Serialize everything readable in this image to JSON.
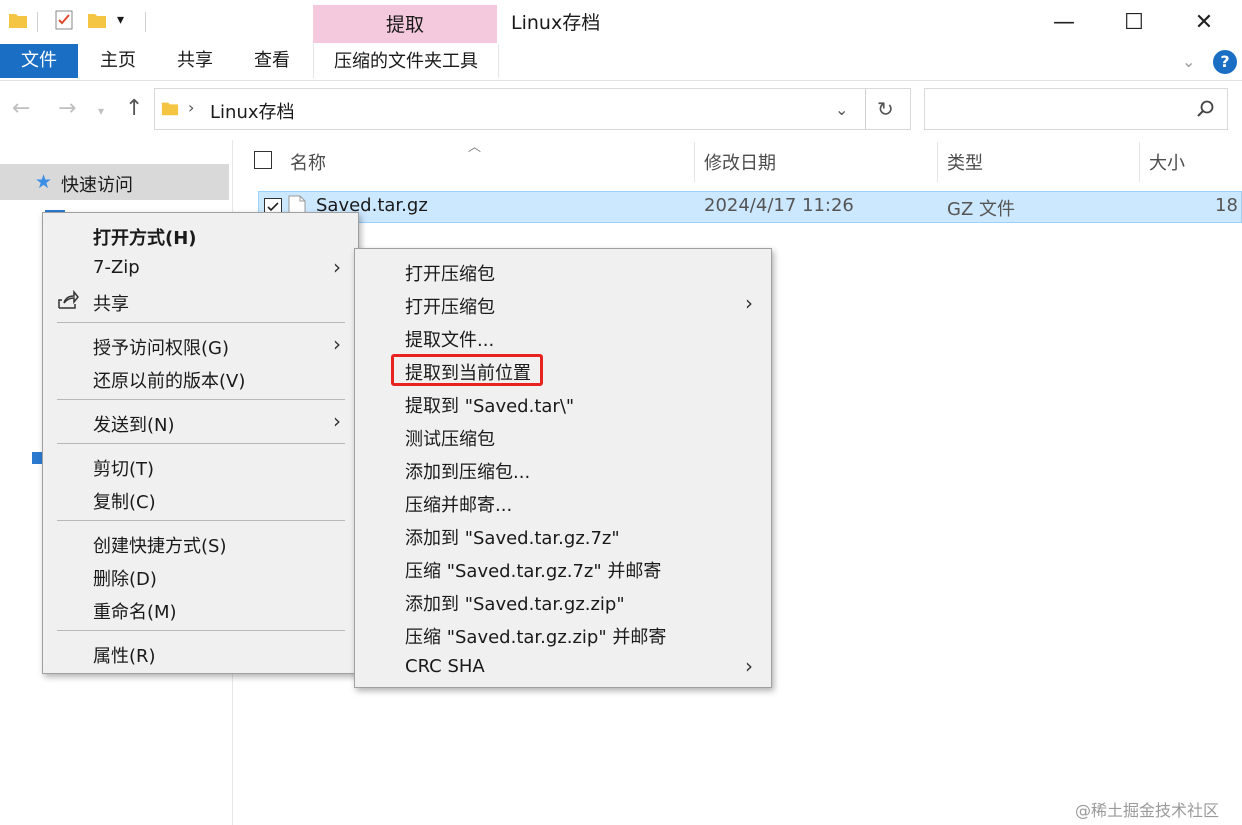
{
  "window": {
    "title": "Linux存档",
    "context_tab": "提取",
    "minimize_glyph": "—",
    "maximize_glyph": "☐",
    "close_glyph": "✕"
  },
  "ribbon": {
    "tabs": [
      "文件",
      "主页",
      "共享",
      "查看"
    ],
    "tools_tab": "压缩的文件夹工具",
    "help_glyph": "?"
  },
  "address": {
    "path": "Linux存档",
    "search_placeholder": ""
  },
  "nav": {
    "quick_access": "快速访问"
  },
  "columns": {
    "name": "名称",
    "modified": "修改日期",
    "type": "类型",
    "size": "大小"
  },
  "files": [
    {
      "name": "Saved.tar.gz",
      "modified": "2024/4/17 11:26",
      "type": "GZ 文件",
      "size": "18"
    }
  ],
  "context_menu": {
    "items": [
      {
        "label": "打开方式(H)",
        "bold": true
      },
      {
        "label": "7-Zip",
        "submenu": true
      },
      {
        "label": "共享"
      },
      {
        "label": "授予访问权限(G)",
        "submenu": true
      },
      {
        "label": "还原以前的版本(V)"
      },
      {
        "label": "发送到(N)",
        "submenu": true
      },
      {
        "label": "剪切(T)"
      },
      {
        "label": "复制(C)"
      },
      {
        "label": "创建快捷方式(S)"
      },
      {
        "label": "删除(D)"
      },
      {
        "label": "重命名(M)"
      },
      {
        "label": "属性(R)"
      }
    ]
  },
  "zip_menu": {
    "items": [
      {
        "label": "打开压缩包"
      },
      {
        "label": "打开压缩包",
        "submenu": true
      },
      {
        "label": "提取文件..."
      },
      {
        "label": "提取到当前位置",
        "highlighted": true
      },
      {
        "label": "提取到 \"Saved.tar\\\""
      },
      {
        "label": "测试压缩包"
      },
      {
        "label": "添加到压缩包..."
      },
      {
        "label": "压缩并邮寄..."
      },
      {
        "label": "添加到 \"Saved.tar.gz.7z\""
      },
      {
        "label": "压缩 \"Saved.tar.gz.7z\" 并邮寄"
      },
      {
        "label": "添加到 \"Saved.tar.gz.zip\""
      },
      {
        "label": "压缩 \"Saved.tar.gz.zip\" 并邮寄"
      },
      {
        "label": "CRC SHA",
        "submenu": true
      }
    ]
  },
  "colors": {
    "accent": "#1a6fc4",
    "context_tab": "#f5c9dd",
    "selection": "#cce8ff",
    "highlight_border": "#e8231f"
  },
  "watermark": "@稀土掘金技术社区"
}
